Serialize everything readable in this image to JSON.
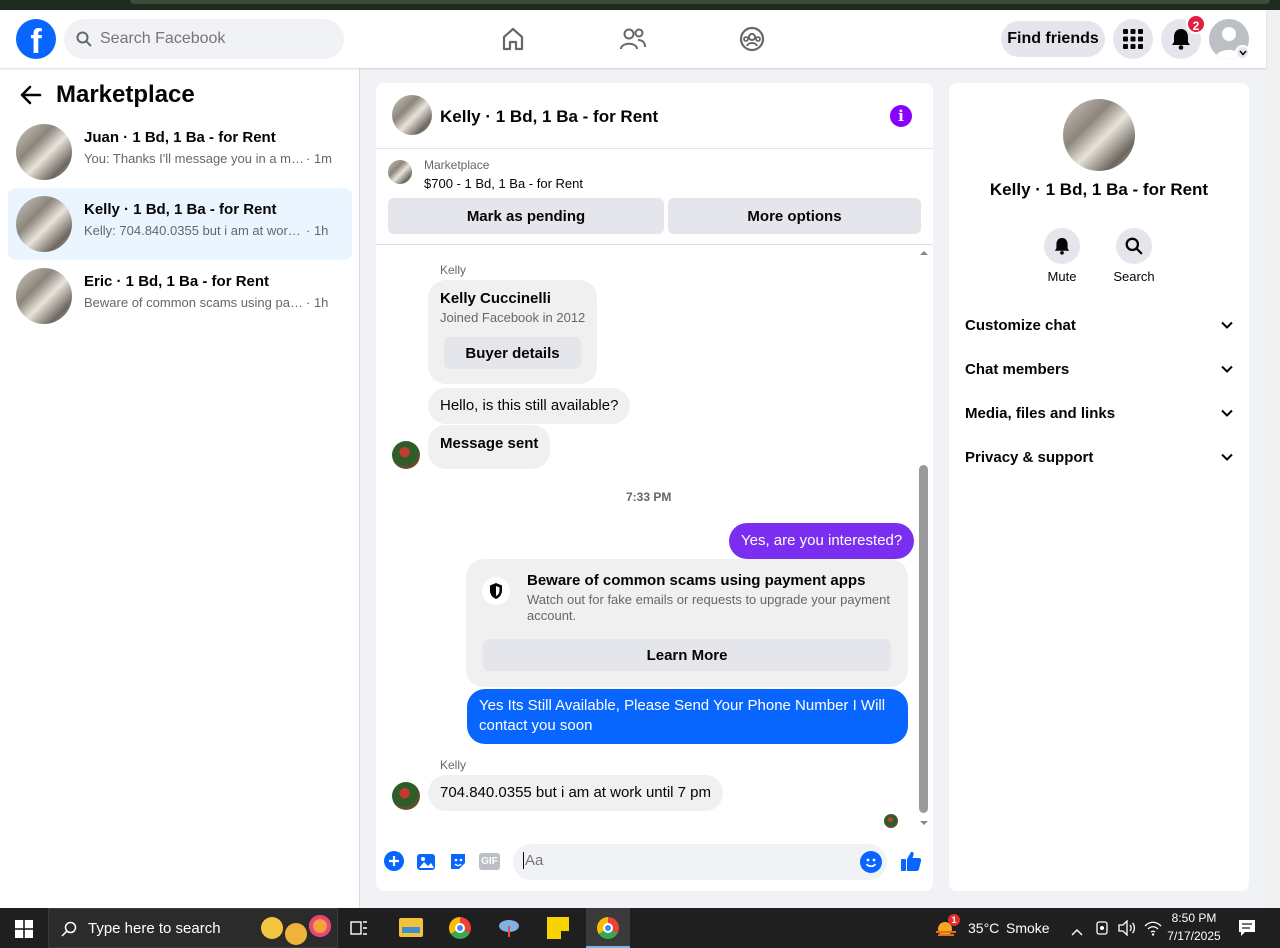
{
  "header": {
    "search_placeholder": "Search Facebook",
    "find_friends": "Find friends",
    "notification_count": "2"
  },
  "left": {
    "title": "Marketplace",
    "conversations": [
      {
        "name": "Juan · 1 Bd, 1 Ba - for Rent",
        "snippet": "You: Thanks I'll message you in a mo...",
        "time": "· 1m"
      },
      {
        "name": "Kelly · 1 Bd, 1 Ba - for Rent",
        "snippet": "Kelly: 704.840.0355 but i am at work u...",
        "time": "· 1h"
      },
      {
        "name": "Eric · 1 Bd, 1 Ba - for Rent",
        "snippet": "Beware of common scams using pay...",
        "time": "· 1h"
      }
    ]
  },
  "chat": {
    "title": "Kelly · 1 Bd, 1 Ba - for Rent",
    "listing_source": "Marketplace",
    "listing_title": "$700 - 1 Bd, 1 Ba - for Rent",
    "mark_pending": "Mark as pending",
    "more_options": "More options",
    "sender_name": "Kelly",
    "buyer_name": "Kelly Cuccinelli",
    "buyer_joined": "Joined Facebook in 2012",
    "buyer_details": "Buyer details",
    "msg1": "Hello, is this still available?",
    "msg2": "Message sent",
    "timestamp": "7:33 PM",
    "msg3": "Yes, are you interested?",
    "scam_title": "Beware of common scams using payment apps",
    "scam_body": "Watch out for fake emails or requests to upgrade your payment account.",
    "learn_more": "Learn More",
    "msg4": "Yes Its Still Available, Please Send Your Phone Number I Will contact you soon",
    "msg5": "704.840.0355 but i am at work until 7 pm",
    "composer_placeholder": "Aa"
  },
  "right": {
    "title": "Kelly · 1 Bd, 1 Ba - for Rent",
    "mute": "Mute",
    "search": "Search",
    "sections": [
      "Customize chat",
      "Chat members",
      "Media, files and links",
      "Privacy & support"
    ]
  },
  "taskbar": {
    "search_placeholder": "Type here to search",
    "weather_badge": "1",
    "temperature": "35°C",
    "weather": "Smoke",
    "time": "8:50 PM",
    "date": "7/17/2025"
  },
  "colors": {
    "brand": "#0866ff",
    "accent_purple": "#8a00ff",
    "notification": "#e41e3f"
  }
}
